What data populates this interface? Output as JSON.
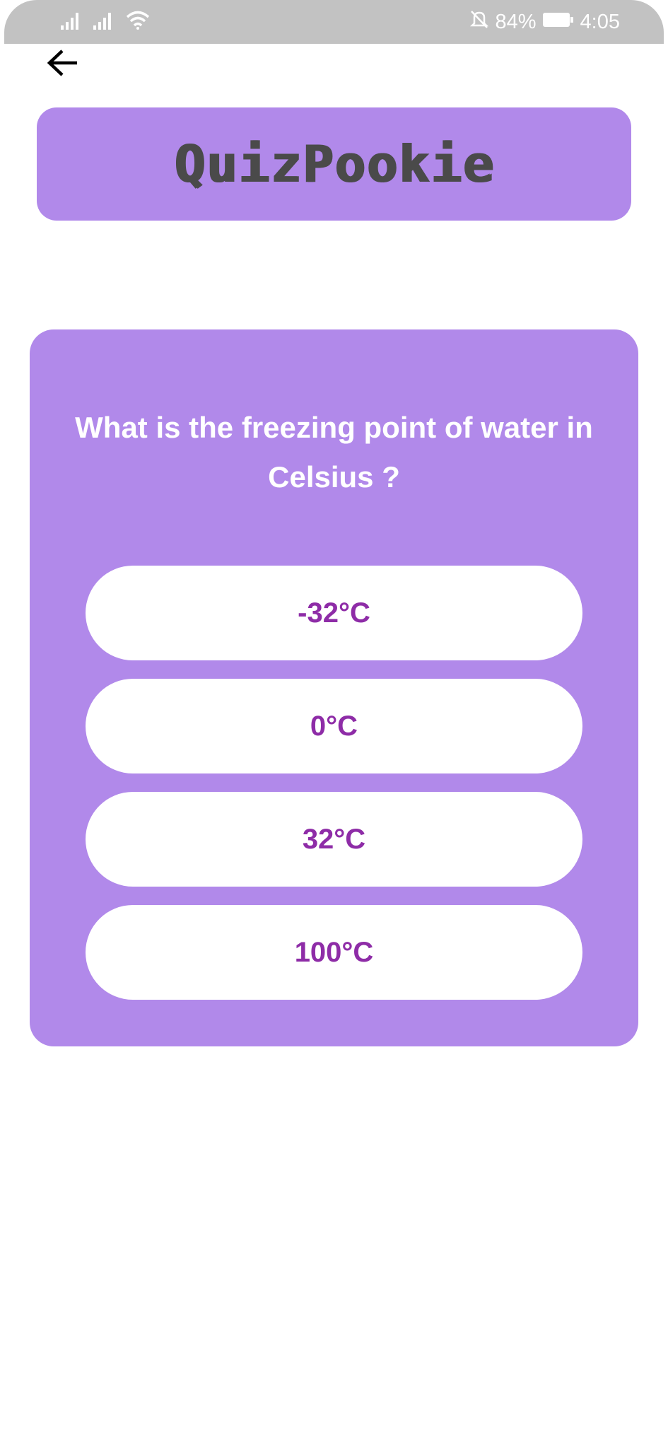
{
  "status_bar": {
    "battery": "84%",
    "time": "4:05",
    "icons": [
      "signal-icon",
      "signal-icon",
      "wifi-icon",
      "bell-off-icon",
      "battery-icon"
    ]
  },
  "header": {
    "back_icon": "arrow-left-icon"
  },
  "app": {
    "title": "QuizPookie"
  },
  "quiz": {
    "question": "What is the freezing point of water in Celsius ?",
    "options": [
      {
        "label": "-32°C"
      },
      {
        "label": "0°C"
      },
      {
        "label": "32°C"
      },
      {
        "label": "100°C"
      }
    ]
  },
  "colors": {
    "accent": "#b189ea",
    "option_text": "#8e2ca7",
    "status_bar": "#c2c2c2",
    "title_text": "#4a4a4a"
  }
}
